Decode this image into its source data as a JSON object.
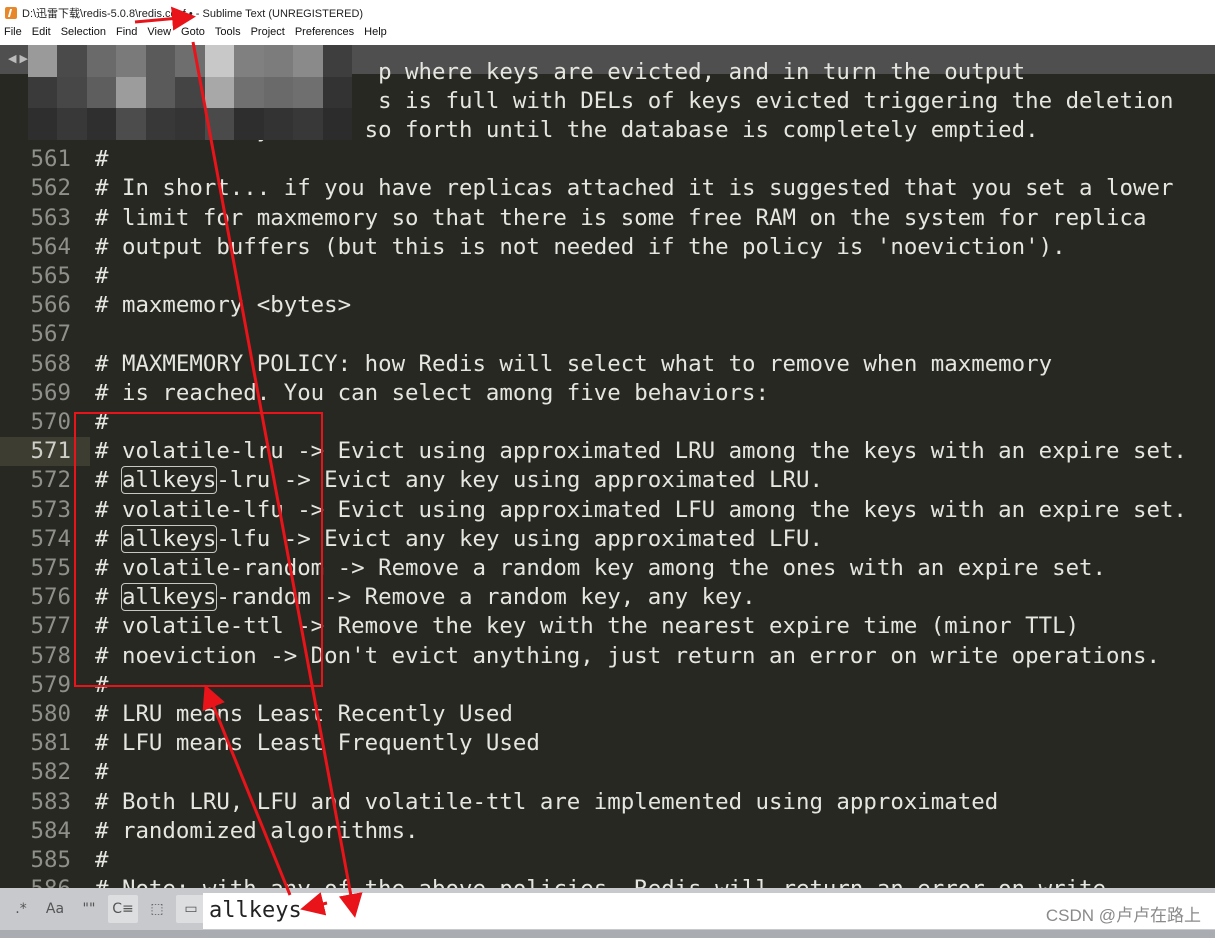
{
  "window": {
    "title": "D:\\迅雷下载\\redis-5.0.8\\redis.conf • - Sublime Text (UNREGISTERED)"
  },
  "menu": [
    "File",
    "Edit",
    "Selection",
    "Find",
    "View",
    "Goto",
    "Tools",
    "Project",
    "Preferences",
    "Help"
  ],
  "tabbar": {
    "nav_arrows": "◀ ▶"
  },
  "editor": {
    "current_line": 571,
    "lines": [
      {
        "n": "558",
        "t": "                     p where keys are evicted, and in turn the output"
      },
      {
        "n": "559",
        "t": "                     s is full with DELs of keys evicted triggering the deletion"
      },
      {
        "n": "560",
        "t": "# of more keys, and so forth until the database is completely emptied."
      },
      {
        "n": "561",
        "t": "#"
      },
      {
        "n": "562",
        "t": "# In short... if you have replicas attached it is suggested that you set a lower"
      },
      {
        "n": "563",
        "t": "# limit for maxmemory so that there is some free RAM on the system for replica"
      },
      {
        "n": "564",
        "t": "# output buffers (but this is not needed if the policy is 'noeviction')."
      },
      {
        "n": "565",
        "t": "#"
      },
      {
        "n": "566",
        "t": "# maxmemory <bytes>"
      },
      {
        "n": "567",
        "t": ""
      },
      {
        "n": "568",
        "t": "# MAXMEMORY POLICY: how Redis will select what to remove when maxmemory"
      },
      {
        "n": "569",
        "t": "# is reached. You can select among five behaviors:"
      },
      {
        "n": "570",
        "t": "#"
      },
      {
        "n": "571",
        "t": "# volatile-lru -> Evict using approximated LRU among the keys with an expire set."
      },
      {
        "n": "572",
        "pre": "# ",
        "m": "allkeys",
        "t": "-lru -> Evict any key using approximated LRU."
      },
      {
        "n": "573",
        "t": "# volatile-lfu -> Evict using approximated LFU among the keys with an expire set."
      },
      {
        "n": "574",
        "pre": "# ",
        "m": "allkeys",
        "t": "-lfu -> Evict any key using approximated LFU."
      },
      {
        "n": "575",
        "t": "# volatile-random -> Remove a random key among the ones with an expire set."
      },
      {
        "n": "576",
        "pre": "# ",
        "m": "allkeys",
        "t": "-random -> Remove a random key, any key."
      },
      {
        "n": "577",
        "t": "# volatile-ttl -> Remove the key with the nearest expire time (minor TTL)"
      },
      {
        "n": "578",
        "t": "# noeviction -> Don't evict anything, just return an error on write operations."
      },
      {
        "n": "579",
        "t": "#"
      },
      {
        "n": "580",
        "t": "# LRU means Least Recently Used"
      },
      {
        "n": "581",
        "t": "# LFU means Least Frequently Used"
      },
      {
        "n": "582",
        "t": "#"
      },
      {
        "n": "583",
        "t": "# Both LRU, LFU and volatile-ttl are implemented using approximated"
      },
      {
        "n": "584",
        "t": "# randomized algorithms."
      },
      {
        "n": "585",
        "t": "#"
      },
      {
        "n": "586",
        "t": "# Note: with any of the above policies, Redis will return an error on write"
      }
    ]
  },
  "findbar": {
    "buttons": [
      ".*",
      "Aa",
      "\"\"",
      "C≡",
      "⬚",
      "▭"
    ],
    "query": "allkeys"
  },
  "watermark": "CSDN @卢卢在路上",
  "colors": {
    "annotation": "#e8141a",
    "editor_bg": "#272822"
  }
}
